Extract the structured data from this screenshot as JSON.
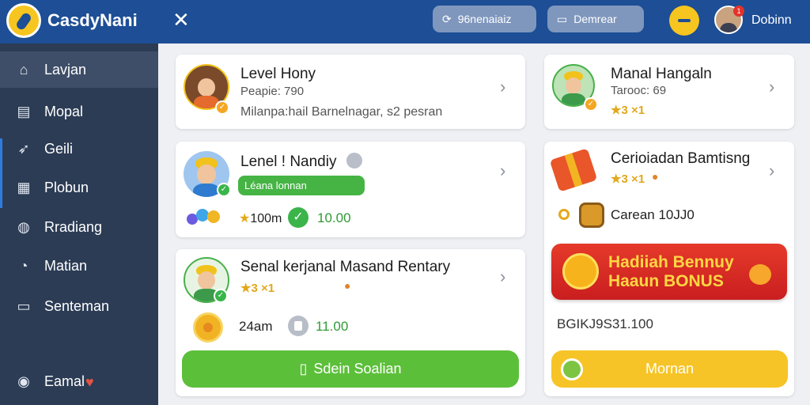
{
  "topbar": {
    "brand": "CasdyNani",
    "close": "✕",
    "pill1": "96nenaiaiz",
    "pill2": "Demrear",
    "notif_count": "1",
    "username": "Dobinn"
  },
  "sidebar": {
    "items": [
      {
        "label": "Lavjan",
        "icon": "home-icon"
      },
      {
        "label": "Mopal",
        "icon": "film-icon"
      },
      {
        "label": "Geili",
        "icon": "rocket-icon"
      },
      {
        "label": "Plobun",
        "icon": "building-icon"
      },
      {
        "label": "Rradiang",
        "icon": "globe-icon"
      },
      {
        "label": "Matian",
        "icon": "chat-icon"
      },
      {
        "label": "Senteman",
        "icon": "message-icon"
      },
      {
        "label": "Eamal",
        "icon": "game-controller-icon"
      }
    ]
  },
  "cards": {
    "c1": {
      "title": "Level Hony",
      "sub": "Peapie: 790",
      "desc": "Milanpa:hail Barnelnagar, s2 pesran"
    },
    "c2": {
      "title": "Lenel ! Nandiy",
      "bar": "Léana lonnan",
      "stat1": "100m",
      "stat2": "10.00"
    },
    "c3": {
      "title": "Senal kerjanal Masand Rentary",
      "stars": "★3 ×1",
      "stat1": "24am",
      "stat2": "11.00",
      "button": "Sdein Soalian"
    },
    "c4": {
      "title": "Manal Hangaln",
      "sub": "Tarooc: 69",
      "stars": "★3 ×1"
    },
    "c5": {
      "title": "Cerioiadan Bamtisng",
      "stars": "★3 ×1",
      "line": "Carean 10JJ0",
      "banner_l1": "Hadiiah Bennuy",
      "banner_l2": "Haaun BONUS",
      "amount": "BGIKJ9S31.100",
      "button": "Mornan"
    }
  },
  "colors": {
    "topbar": "#1d4e96",
    "sidebar": "#2c3c55",
    "accent_green": "#5cbf3a",
    "accent_yellow": "#f6c427",
    "banner_red": "#d9291f"
  }
}
